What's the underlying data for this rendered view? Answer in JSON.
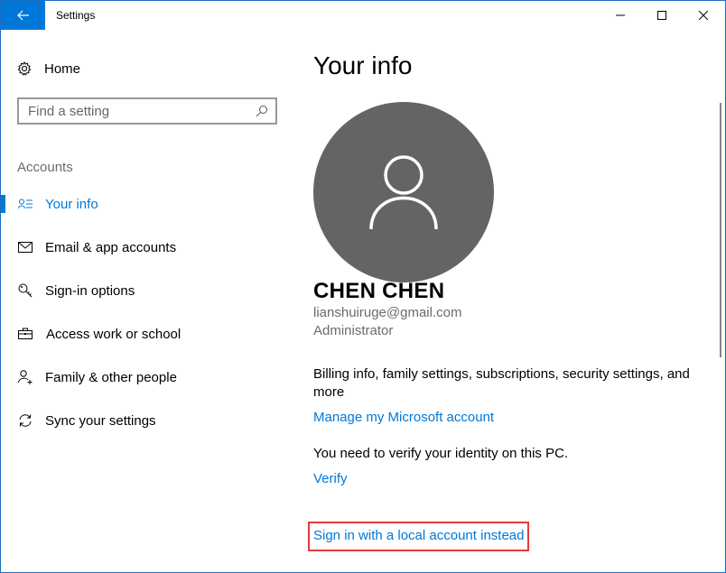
{
  "window": {
    "title": "Settings",
    "controls": {
      "minimize": "minimize",
      "maximize": "maximize",
      "close": "close"
    },
    "accent_color": "#0078d7"
  },
  "sidebar": {
    "home_label": "Home",
    "search": {
      "placeholder": "Find a setting",
      "value": ""
    },
    "section_header": "Accounts",
    "items": [
      {
        "label": "Your info",
        "icon": "contact-info-icon",
        "active": true
      },
      {
        "label": "Email & app accounts",
        "icon": "mail-icon",
        "active": false
      },
      {
        "label": "Sign-in options",
        "icon": "key-icon",
        "active": false
      },
      {
        "label": "Access work or school",
        "icon": "briefcase-icon",
        "active": false
      },
      {
        "label": "Family & other people",
        "icon": "add-person-icon",
        "active": false
      },
      {
        "label": "Sync your settings",
        "icon": "sync-icon",
        "active": false
      }
    ]
  },
  "main": {
    "title": "Your info",
    "user": {
      "name": "CHEN CHEN",
      "email": "lianshuiruge@gmail.com",
      "role": "Administrator"
    },
    "billing_text": "Billing info, family settings, subscriptions, security settings, and more",
    "manage_link": "Manage my Microsoft account",
    "verify_text": "You need to verify your identity on this PC.",
    "verify_link": "Verify",
    "local_account_link": "Sign in with a local account instead",
    "highlight_color": "#e8383d"
  }
}
